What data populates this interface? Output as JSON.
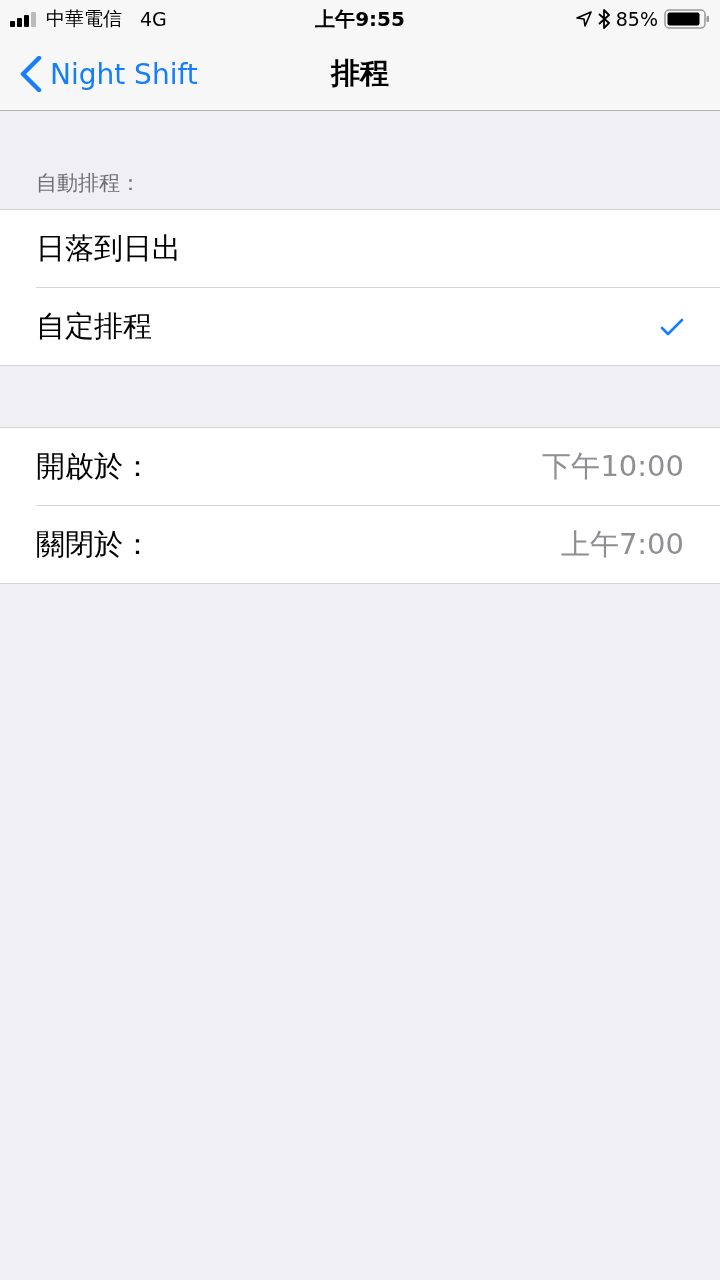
{
  "status_bar": {
    "carrier": "中華電信",
    "network": "4G",
    "time": "上午9:55",
    "battery": "85%"
  },
  "nav": {
    "back": "Night Shift",
    "title": "排程"
  },
  "schedule": {
    "header": "自動排程：",
    "options": [
      {
        "label": "日落到日出",
        "selected": false
      },
      {
        "label": "自定排程",
        "selected": true
      }
    ]
  },
  "times": [
    {
      "label": "開啟於：",
      "value": "下午10:00"
    },
    {
      "label": "關閉於：",
      "value": "上午7:00"
    }
  ]
}
